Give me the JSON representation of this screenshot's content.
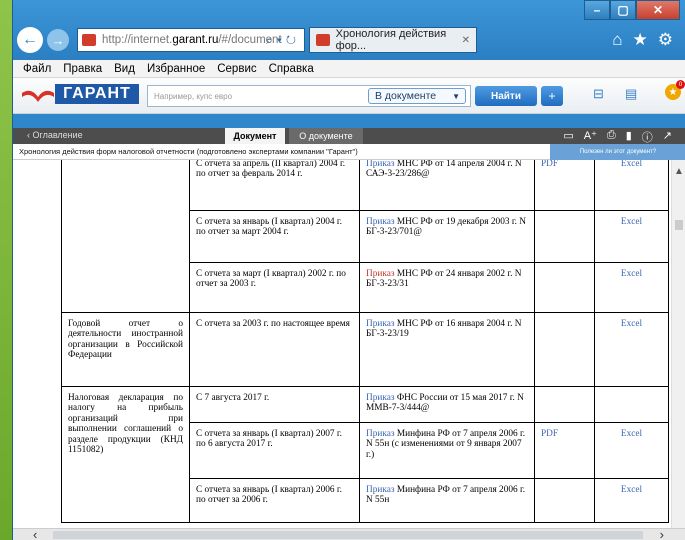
{
  "browser": {
    "url_prefix": "http://internet.",
    "url_domain": "garant.ru",
    "url_suffix": "/#/document",
    "tab_title": "Хронология действия фор...",
    "window_controls": [
      "–",
      "▢",
      "✕"
    ]
  },
  "menu": [
    "Файл",
    "Правка",
    "Вид",
    "Избранное",
    "Сервис",
    "Справка"
  ],
  "garant": {
    "logo_text": "ГАРАНТ",
    "search_placeholder": "Например, купс евро",
    "scope": "В документе",
    "find_button": "Найти",
    "plus_button": "+",
    "notification_count": "0"
  },
  "doc_tabs": {
    "toc": "‹ Оглавление",
    "document": "Документ",
    "about": "О документе"
  },
  "doc_header": {
    "title": "Хронология действия форм налоговой отчетности (подготовлено экспертами компании \"Гарант\")",
    "feedback": "Полезен ли этот документ?"
  },
  "table": {
    "rows": [
      {
        "c1": "",
        "c2": "С отчета за апрель (II квартал) 2004 г. по отчет за февраль 2014 г.",
        "c3_link": "Приказ",
        "c3_link_red": false,
        "c3_rest": " МНС РФ от 14 апреля 2004 г. N САЭ-3-23/286@",
        "c4": "PDF",
        "c5": "Excel"
      },
      {
        "c1": "",
        "c2": "С отчета за январь (I квартал) 2004 г. по отчет за март 2004 г.",
        "c3_link": "Приказ",
        "c3_link_red": false,
        "c3_rest": " МНС РФ от 19 декабря 2003 г. N БГ-3-23/701@",
        "c4": "",
        "c5": "Excel"
      },
      {
        "c1": "",
        "c2": "С отчета за март (I квартал) 2002 г. по отчет за 2003 г.",
        "c3_link": "Приказ",
        "c3_link_red": true,
        "c3_rest": " МНС РФ от 24 января 2002 г. N БГ-3-23/31",
        "c4": "",
        "c5": "Excel"
      },
      {
        "c1": "Годовой отчет о деятельности иностранной организации в Российской Федерации",
        "c2": "С отчета за 2003 г. по настоящее время",
        "c3_link": "Приказ",
        "c3_link_red": false,
        "c3_rest": " МНС РФ от 16 января 2004 г. N БГ-3-23/19",
        "c4": "",
        "c5": "Excel"
      },
      {
        "c1": "Налоговая декларация по налогу на прибыль организаций при выполнении соглашений о разделе продукции (КНД 1151082)",
        "c2": "С 7 августа 2017 г.",
        "c3_link": "Приказ",
        "c3_link_red": false,
        "c3_rest": " ФНС России от 15 мая 2017 г. N ММВ-7-3/444@",
        "c4": "",
        "c5": ""
      },
      {
        "c1": "",
        "c2": "С отчета за январь (I квартал) 2007 г. по 6 августа 2017 г.",
        "c3_link": "Приказ",
        "c3_link_red": false,
        "c3_rest": " Минфина РФ от 7 апреля 2006 г. N 55н (с изменениями от 9 января 2007 г.)",
        "c4": "PDF",
        "c5": "Excel"
      },
      {
        "c1": "",
        "c2": "С отчета за январь (I квартал) 2006 г. по отчет за 2006 г.",
        "c3_link": "Приказ",
        "c3_link_red": false,
        "c3_rest": " Минфина РФ от 7 апреля 2006 г. N 55н",
        "c4": "",
        "c5": "Excel"
      }
    ]
  }
}
